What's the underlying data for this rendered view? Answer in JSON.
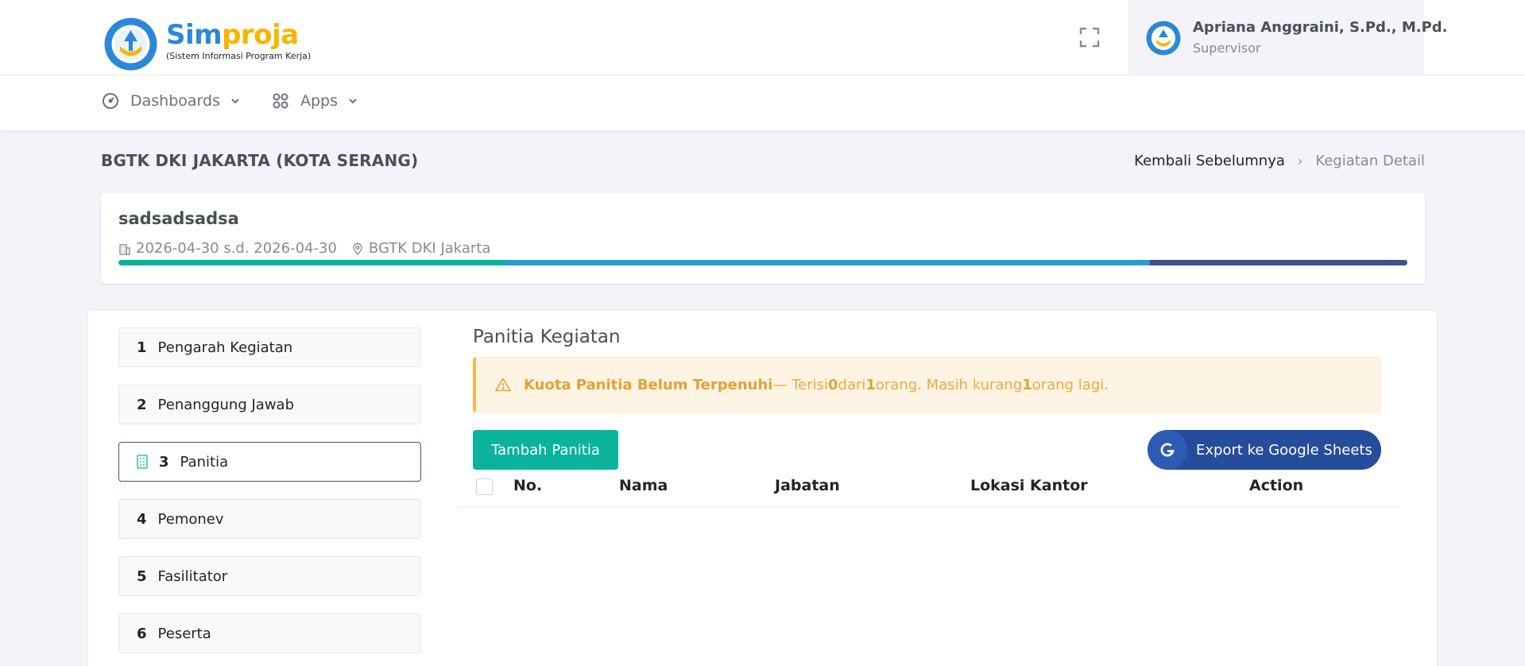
{
  "brand": {
    "part1": "Sim",
    "part2": "proja",
    "subtitle": "(Sistem Informasi Program Kerja)"
  },
  "user": {
    "name": "Apriana Anggraini, S.Pd., M.Pd.",
    "role": "Supervisor"
  },
  "nav": {
    "dashboards": "Dashboards",
    "apps": "Apps"
  },
  "page": {
    "title": "BGTK DKI JAKARTA (KOTA SERANG)"
  },
  "breadcrumb": {
    "back": "Kembali Sebelumnya",
    "current": "Kegiatan Detail"
  },
  "event": {
    "title": "sadsadsadsa",
    "dates": "2026-04-30 s.d. 2026-04-30",
    "location": "BGTK DKI Jakarta",
    "progress_colors": [
      "#0ab39c",
      "#299cdb",
      "#405189"
    ]
  },
  "steps": [
    {
      "num": "1",
      "label": "Pengarah Kegiatan"
    },
    {
      "num": "2",
      "label": "Penanggung Jawab"
    },
    {
      "num": "3",
      "label": "Panitia"
    },
    {
      "num": "4",
      "label": "Pemonev"
    },
    {
      "num": "5",
      "label": "Fasilitator"
    },
    {
      "num": "6",
      "label": "Peserta"
    }
  ],
  "section": {
    "title": "Panitia Kegiatan"
  },
  "alert": {
    "strong": "Kuota Panitia Belum Terpenuhi",
    "t1": " — Terisi ",
    "filled": "0",
    "t2": " dari ",
    "quota": "1",
    "t3": " orang. Masih kurang ",
    "missing": "1",
    "t4": " orang lagi."
  },
  "buttons": {
    "add": "Tambah Panitia",
    "export": "Export ke Google Sheets"
  },
  "table": {
    "headers": [
      "No.",
      "Nama",
      "Jabatan",
      "Lokasi Kantor",
      "Action"
    ]
  },
  "colors": {
    "primary": "#405189",
    "success": "#0ab39c",
    "warning": "#f7b84b",
    "export": "#264d9b"
  }
}
